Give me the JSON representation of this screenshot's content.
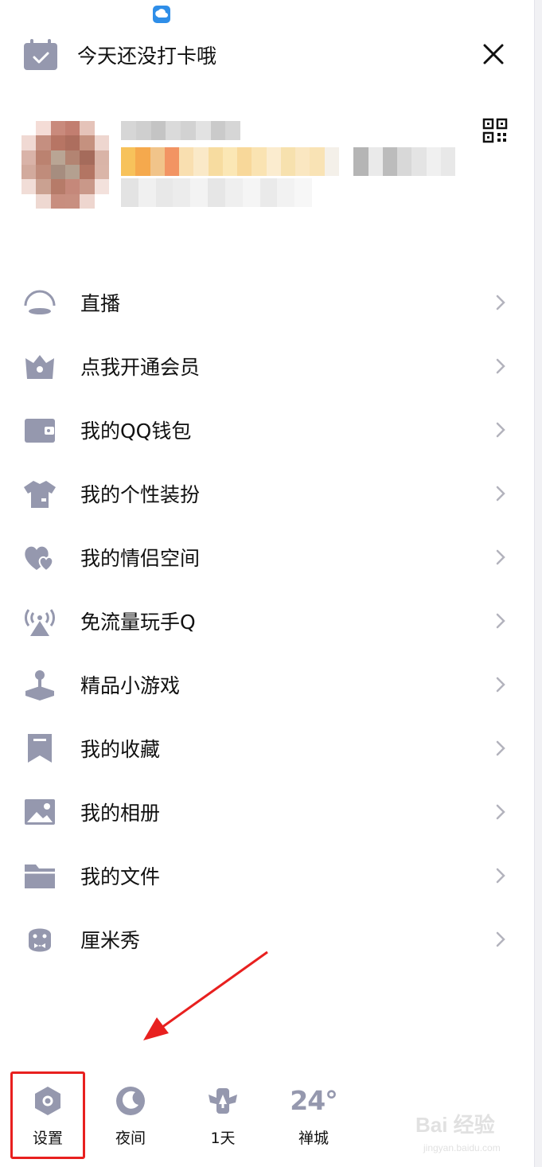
{
  "header": {
    "checkin_text": "今天还没打卡哦"
  },
  "menu": {
    "items": [
      {
        "label": "直播",
        "icon": "live-icon"
      },
      {
        "label": "点我开通会员",
        "icon": "crown-icon"
      },
      {
        "label": "我的QQ钱包",
        "icon": "wallet-icon"
      },
      {
        "label": "我的个性装扮",
        "icon": "tshirt-icon"
      },
      {
        "label": "我的情侣空间",
        "icon": "hearts-icon"
      },
      {
        "label": "免流量玩手Q",
        "icon": "signal-tower-icon"
      },
      {
        "label": "精品小游戏",
        "icon": "joystick-icon"
      },
      {
        "label": "我的收藏",
        "icon": "bookmark-icon"
      },
      {
        "label": "我的相册",
        "icon": "picture-icon"
      },
      {
        "label": "我的文件",
        "icon": "folder-icon"
      },
      {
        "label": "厘米秀",
        "icon": "cmshow-face-icon"
      }
    ]
  },
  "bottom_bar": {
    "settings_label": "设置",
    "night_label": "夜间",
    "days_label": "1天",
    "weather_temp": "24°",
    "weather_city": "禅城"
  },
  "watermark": {
    "main": "Bai 经验",
    "sub": "jingyan.baidu.com"
  },
  "colors": {
    "icon_gray": "#9598ae",
    "annotation_red": "#e8201f",
    "text": "#111111"
  }
}
